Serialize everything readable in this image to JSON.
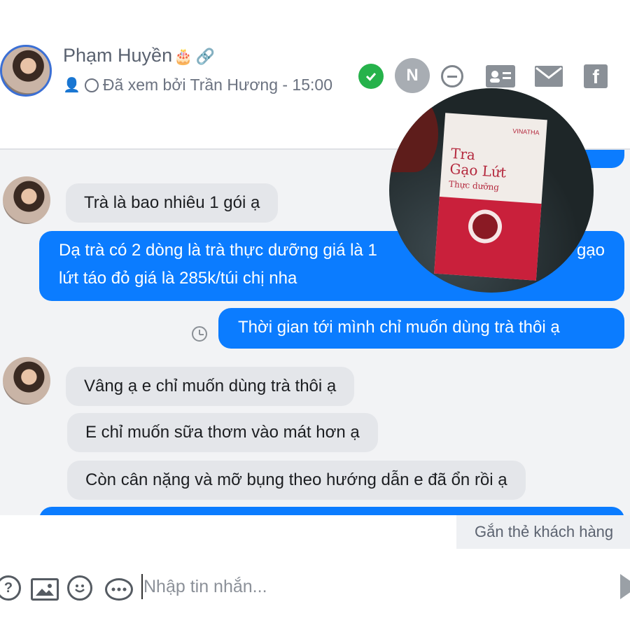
{
  "header": {
    "contact_name": "Phạm Huyền",
    "birthday_icon": "cake-icon",
    "link_icon": "link-icon",
    "seen_text": "Đã xem bởi Trần Hương - 15:00",
    "status_icons": [
      "check-circle-icon",
      "n-badge-icon",
      "minus-circle-icon",
      "contact-card-icon",
      "mail-icon",
      "facebook-icon"
    ],
    "n_badge": "N",
    "fb_letter": "f"
  },
  "conversation": {
    "messages": [
      {
        "dir": "in",
        "text": "Trà là bao nhiêu 1 gói ạ"
      },
      {
        "dir": "out",
        "text_line1": "Dạ trà có 2 dòng là trà thực dưỡng giá là 1",
        "text_line1_end": "gạo",
        "text_line2": "lứt táo đỏ giá là 285k/túi chị nha"
      },
      {
        "dir": "out",
        "text": "Thời gian tới mình chỉ muốn dùng trà thôi ạ"
      },
      {
        "dir": "in",
        "text": "Vâng ạ e chỉ muốn dùng trà thôi ạ"
      },
      {
        "dir": "in",
        "text": "E chỉ muốn sữa thơm vào mát hơn ạ"
      },
      {
        "dir": "in",
        "text": "Còn cân nặng và mỡ bụng theo hướng dẫn e đã ổn rồi ạ"
      }
    ],
    "product_photo": {
      "brand": "VINATHA",
      "title_line1": "Tra",
      "title_line2": "Gạo Lứt",
      "title_line3": "Thực dưỡng"
    }
  },
  "tag_customer_label": "Gắn thẻ khách hàng",
  "composer": {
    "placeholder": "Nhập tin nhắn...",
    "icons": [
      "help-icon",
      "image-icon",
      "emoji-icon",
      "quick-reply-icon",
      "send-icon"
    ]
  },
  "colors": {
    "outgoing_bubble": "#0b7cff",
    "incoming_bubble": "#e4e6ea",
    "online_check": "#26b24b"
  }
}
